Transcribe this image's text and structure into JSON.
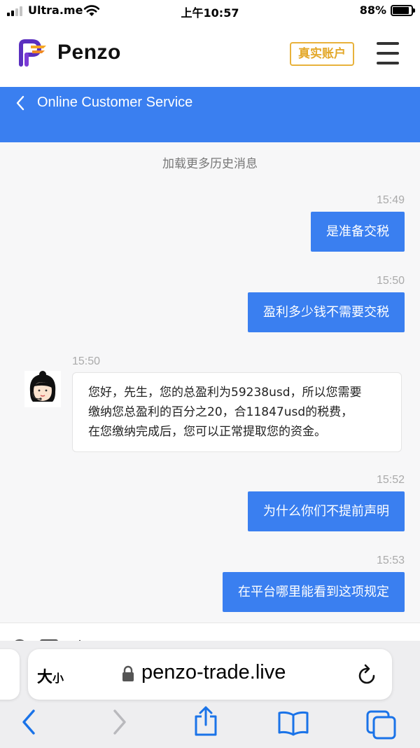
{
  "status_bar": {
    "carrier": "Ultra.me",
    "time": "上午10:57",
    "battery": "88%",
    "battery_level": 0.88
  },
  "header": {
    "logo_text": "Penzo",
    "account_button": "真实账户"
  },
  "service": {
    "title": "Online Customer Service"
  },
  "chat": {
    "load_more": "加载更多历史消息",
    "messages": [
      {
        "time": "15:49",
        "from": "user",
        "text": "是准备交税"
      },
      {
        "time": "15:50",
        "from": "user",
        "text": "盈利多少钱不需要交税"
      },
      {
        "time": "15:50",
        "from": "agent",
        "lines": [
          "您好，先生，您的总盈利为59238usd，所以您需要",
          "缴纳您总盈利的百分之20，合11847usd的税费，",
          "在您缴纳完成后，您可以正常提取您的资金。"
        ]
      },
      {
        "time": "15:52",
        "from": "user",
        "text": "为什么你们不提前声明"
      },
      {
        "time": "15:53",
        "from": "user",
        "text": "在平台哪里能看到这项规定"
      }
    ]
  },
  "browser": {
    "text_size_big": "大",
    "text_size_small": "小",
    "url": "penzo-trade.live"
  },
  "colors": {
    "brand_blue": "#3a7ff0",
    "account_gold": "#e3a82a",
    "ios_blue": "#1a73e8"
  }
}
